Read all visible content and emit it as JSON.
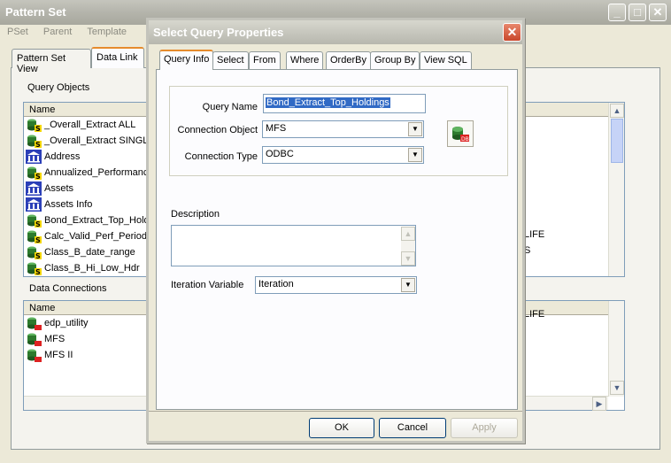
{
  "window": {
    "title": "Pattern Set",
    "menu": [
      "PSet",
      "Parent",
      "Template"
    ],
    "tabs": [
      "Pattern Set View",
      "Data Link"
    ],
    "query_objects": {
      "label": "Query Objects",
      "column": "Name",
      "items": [
        {
          "name": "_Overall_Extract ALL",
          "icon": "sql-db-icon"
        },
        {
          "name": "_Overall_Extract SINGLE",
          "icon": "sql-db-icon"
        },
        {
          "name": "Address",
          "icon": "bank-icon"
        },
        {
          "name": "Annualized_Performance",
          "icon": "sql-db-icon"
        },
        {
          "name": "Assets",
          "icon": "bank-icon"
        },
        {
          "name": "Assets Info",
          "icon": "bank-icon"
        },
        {
          "name": "Bond_Extract_Top_Holdings",
          "icon": "sql-db-icon"
        },
        {
          "name": "Calc_Valid_Perf_Period",
          "icon": "sql-db-icon"
        },
        {
          "name": "Class_B_date_range",
          "icon": "sql-db-icon"
        },
        {
          "name": "Class_B_Hi_Low_Hdr",
          "icon": "sql-db-icon"
        }
      ]
    },
    "data_connections": {
      "label": "Data Connections",
      "column": "Name",
      "items": [
        "edp_utility",
        "MFS",
        "MFS II"
      ]
    },
    "right_fragments": [
      "LIFE",
      "S",
      "LIFE"
    ]
  },
  "dialog": {
    "title": "Select Query Properties",
    "tabs": [
      "Query Info",
      "Select",
      "From",
      "Where",
      "OrderBy",
      "Group By",
      "View SQL"
    ],
    "active_tab": "Query Info",
    "query_name_label": "Query Name",
    "query_name_value": "Bond_Extract_Top_Holdings",
    "connection_object_label": "Connection Object",
    "connection_object_value": "MFS",
    "connection_type_label": "Connection Type",
    "connection_type_value": "ODBC",
    "description_label": "Description",
    "iteration_label": "Iteration Variable",
    "iteration_value": "Iteration",
    "ok_label": "OK",
    "cancel_label": "Cancel",
    "apply_label": "Apply"
  }
}
